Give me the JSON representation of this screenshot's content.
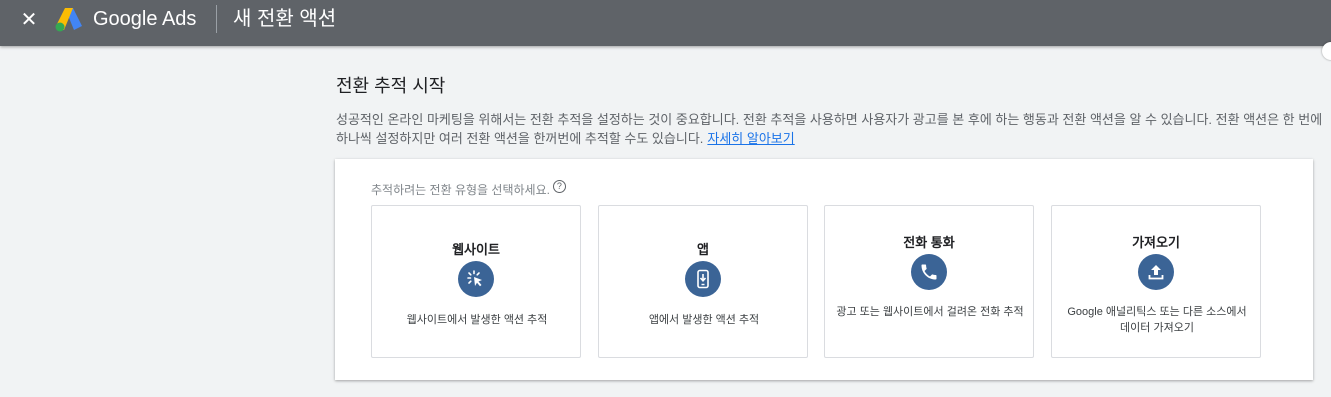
{
  "header": {
    "close_glyph": "✕",
    "brand": "Google Ads",
    "title": "새 전환 액션"
  },
  "main": {
    "section_title": "전환 추적 시작",
    "description": "성공적인 온라인 마케팅을 위해서는 전환 추적을 설정하는 것이 중요합니다. 전환 추적을 사용하면 사용자가 광고를 본 후에 하는 행동과 전환 액션을 알 수 있습니다. 전환 액션은 한 번에 하나씩 설정하지만 여러 전환 액션을 한꺼번에 추적할 수도 있습니다.",
    "learn_more": "자세히 알아보기",
    "card": {
      "prompt": "추적하려는 전환 유형을 선택하세요.",
      "help_glyph": "?",
      "tiles": [
        {
          "title": "웹사이트",
          "icon": "cursor-click-icon",
          "desc": "웹사이트에서 발생한 액션 추적"
        },
        {
          "title": "앱",
          "icon": "mobile-app-icon",
          "desc": "앱에서 발생한 액션 추적"
        },
        {
          "title": "전화 통화",
          "icon": "phone-icon",
          "desc": "광고 또는 웹사이트에서 걸려온 전화 추적"
        },
        {
          "title": "가져오기",
          "icon": "upload-icon",
          "desc": "Google 애널리틱스 또는 다른 소스에서 데이터 가져오기"
        }
      ]
    }
  },
  "colors": {
    "topbar": "#5f6368",
    "accent_icon": "#3b6496",
    "link": "#1a73e8",
    "background": "#f1f3f4"
  }
}
